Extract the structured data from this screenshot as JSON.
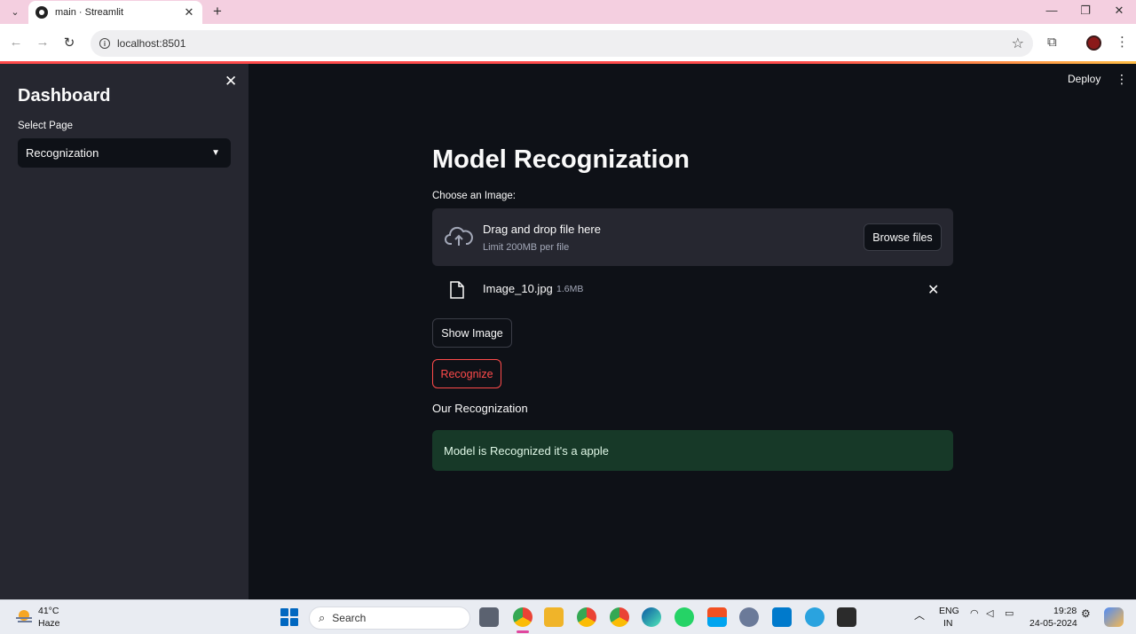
{
  "browser": {
    "tab_title": "main · Streamlit",
    "url": "localhost:8501"
  },
  "app": {
    "deploy_label": "Deploy",
    "sidebar": {
      "title": "Dashboard",
      "select_label": "Select Page",
      "select_value": "Recognization"
    },
    "main": {
      "title": "Model Recognization",
      "uploader_label": "Choose an Image:",
      "dropzone_main": "Drag and drop file here",
      "dropzone_sub": "Limit 200MB per file",
      "browse_label": "Browse files",
      "file_name": "Image_10.jpg",
      "file_size": "1.6MB",
      "show_image_label": "Show Image",
      "recognize_label": "Recognize",
      "subheader": "Our Recognization",
      "success_message": "Model is Recognized it's a apple"
    },
    "accent_color": "#ff4b4b",
    "success_bg": "#173928"
  },
  "taskbar": {
    "temperature": "41°C",
    "weather": "Haze",
    "search_placeholder": "Search",
    "lang_line1": "ENG",
    "lang_line2": "IN",
    "time": "19:28",
    "date": "24-05-2024"
  }
}
